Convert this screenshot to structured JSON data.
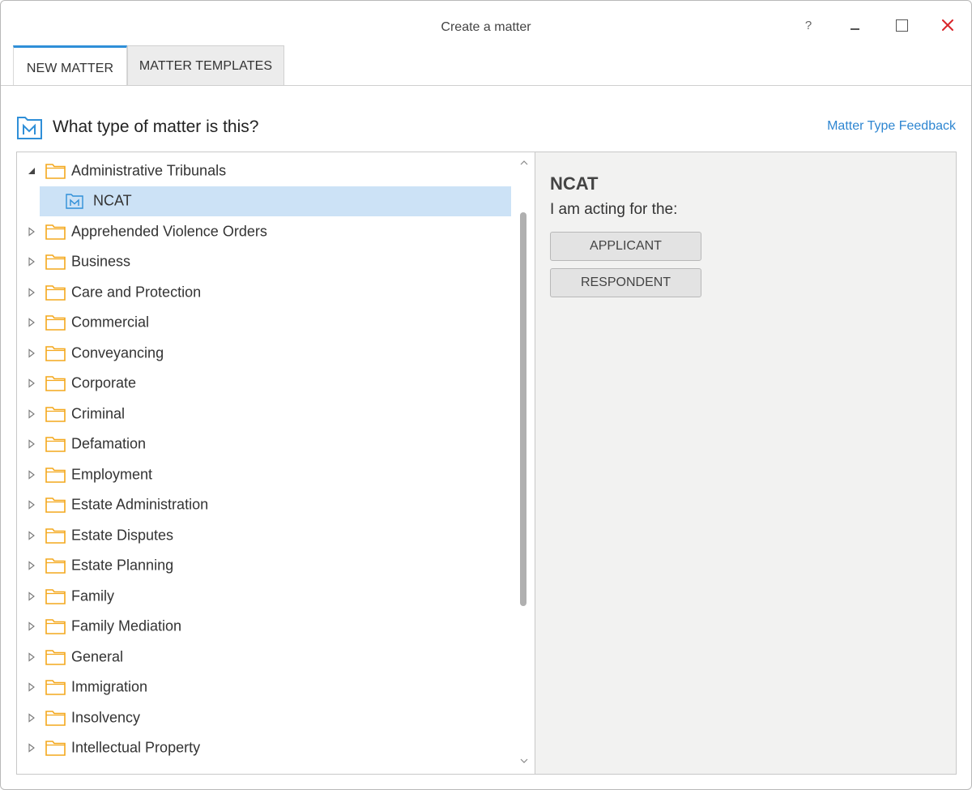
{
  "window": {
    "title": "Create a matter",
    "help_glyph": "?",
    "controls": [
      "help-icon",
      "minimize-icon",
      "maximize-icon",
      "close-icon"
    ]
  },
  "tabs": [
    {
      "label": "NEW MATTER",
      "active": true
    },
    {
      "label": "MATTER TEMPLATES",
      "active": false
    }
  ],
  "header": {
    "question": "What type of matter is this?",
    "feedback_link": "Matter Type Feedback"
  },
  "tree": {
    "expanded_group": "Administrative Tribunals",
    "selected_child": "NCAT",
    "items": [
      {
        "label": "Apprehended Violence Orders"
      },
      {
        "label": "Business"
      },
      {
        "label": "Care and Protection"
      },
      {
        "label": "Commercial"
      },
      {
        "label": "Conveyancing"
      },
      {
        "label": "Corporate"
      },
      {
        "label": "Criminal"
      },
      {
        "label": "Defamation"
      },
      {
        "label": "Employment"
      },
      {
        "label": "Estate Administration"
      },
      {
        "label": "Estate Disputes"
      },
      {
        "label": "Estate Planning"
      },
      {
        "label": "Family"
      },
      {
        "label": "Family Mediation"
      },
      {
        "label": "General"
      },
      {
        "label": "Immigration"
      },
      {
        "label": "Insolvency"
      },
      {
        "label": "Intellectual Property"
      }
    ]
  },
  "details": {
    "title": "NCAT",
    "subtitle": "I am acting for the:",
    "buttons": [
      {
        "label": "APPLICANT"
      },
      {
        "label": "RESPONDENT"
      }
    ]
  },
  "colors": {
    "accent": "#2f8fd8",
    "link": "#2e86d1",
    "folder": "#f4a81d",
    "selection": "#cce2f6",
    "close": "#d9252a"
  }
}
